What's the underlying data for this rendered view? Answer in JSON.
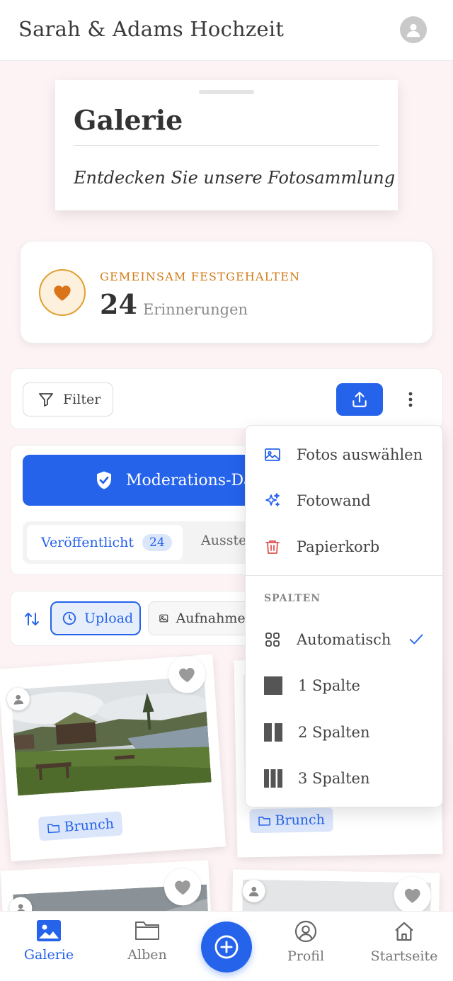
{
  "header": {
    "title": "Sarah & Adams Hochzeit",
    "avatar_icon": "user-icon"
  },
  "gallery_card": {
    "title": "Galerie",
    "subtitle": "Entdecken Sie unsere Fotosammlung"
  },
  "memories": {
    "kicker": "GEMEINSAM FESTGEHALTEN",
    "count": "24",
    "label": "Erinnerungen",
    "icon": "heart-icon"
  },
  "toolbar": {
    "filter_label": "Filter",
    "upload_icon": "upload-icon",
    "more_icon": "more-vertical-icon"
  },
  "moderation": {
    "button_label": "Moderations-Dashboard",
    "tabs": [
      {
        "label": "Veröffentlicht",
        "count": "24"
      },
      {
        "label": "Ausstehend"
      }
    ]
  },
  "sort": {
    "icon": "sort-icon",
    "chips": [
      {
        "label": "Upload"
      },
      {
        "label": "Aufnahmedatum"
      }
    ]
  },
  "photos": [
    {
      "album": "Brunch"
    },
    {
      "album": "Brunch"
    }
  ],
  "dropdown": {
    "items": [
      {
        "label": "Fotos auswählen",
        "icon": "image-icon"
      },
      {
        "label": "Fotowand",
        "icon": "sparkles-icon"
      },
      {
        "label": "Papierkorb",
        "icon": "trash-icon"
      }
    ],
    "section_label": "SPALTEN",
    "columns": [
      {
        "label": "Automatisch",
        "icon": "grid-icon",
        "selected": true
      },
      {
        "label": "1 Spalte",
        "icon": "one-column-icon"
      },
      {
        "label": "2 Spalten",
        "icon": "two-columns-icon"
      },
      {
        "label": "3 Spalten",
        "icon": "three-columns-icon"
      }
    ]
  },
  "bottom_nav": {
    "items": [
      {
        "label": "Galerie",
        "active": true
      },
      {
        "label": "Alben"
      },
      {
        "label": "Profil"
      },
      {
        "label": "Startseite"
      }
    ]
  },
  "colors": {
    "accent": "#2563eb",
    "memory_accent": "#d07a16"
  }
}
